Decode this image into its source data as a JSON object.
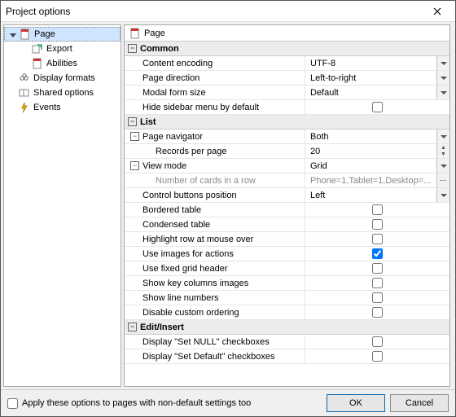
{
  "title": "Project options",
  "nav": {
    "page": "Page",
    "export": "Export",
    "abilities": "Abilities",
    "display_formats": "Display formats",
    "shared_options": "Shared options",
    "events": "Events"
  },
  "content_header": "Page",
  "sections": {
    "common": {
      "title": "Common",
      "rows": {
        "content_encoding": {
          "label": "Content encoding",
          "value": "UTF-8"
        },
        "page_direction": {
          "label": "Page direction",
          "value": "Left-to-right"
        },
        "modal_form_size": {
          "label": "Modal form size",
          "value": "Default"
        },
        "hide_sidebar_default": {
          "label": "Hide sidebar menu by default",
          "checked": false
        }
      }
    },
    "list": {
      "title": "List",
      "rows": {
        "page_navigator": {
          "label": "Page navigator",
          "value": "Both"
        },
        "records_per_page": {
          "label": "Records per page",
          "value": "20"
        },
        "view_mode": {
          "label": "View mode",
          "value": "Grid"
        },
        "num_cards": {
          "label": "Number of cards in a row",
          "value": "Phone=1,Tablet=1,Desktop=..."
        },
        "ctrl_btn_pos": {
          "label": "Control buttons position",
          "value": "Left"
        },
        "bordered_table": {
          "label": "Bordered table",
          "checked": false
        },
        "condensed_table": {
          "label": "Condensed table",
          "checked": false
        },
        "highlight_hover": {
          "label": "Highlight row at mouse over",
          "checked": false
        },
        "use_images_actions": {
          "label": "Use images for actions",
          "checked": true
        },
        "use_fixed_grid_header": {
          "label": "Use fixed grid header",
          "checked": false
        },
        "show_key_col_images": {
          "label": "Show key columns images",
          "checked": false
        },
        "show_line_numbers": {
          "label": "Show line numbers",
          "checked": false
        },
        "disable_custom_ordering": {
          "label": "Disable custom ordering",
          "checked": false
        }
      }
    },
    "edit_insert": {
      "title": "Edit/Insert",
      "rows": {
        "display_set_null": {
          "label": "Display \"Set NULL\" checkboxes",
          "checked": false
        },
        "display_set_default": {
          "label": "Display \"Set Default\" checkboxes",
          "checked": false
        }
      }
    }
  },
  "footer": {
    "apply_non_default": "Apply these options to pages with non-default settings too",
    "ok": "OK",
    "cancel": "Cancel"
  }
}
